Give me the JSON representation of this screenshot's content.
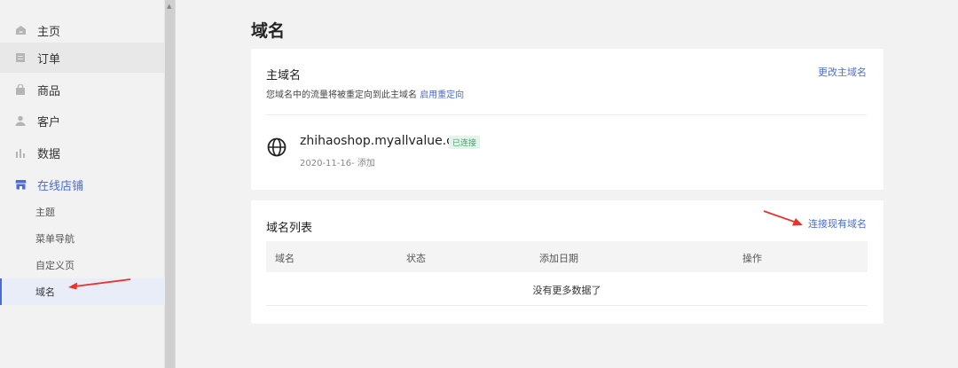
{
  "sidebar": {
    "items": [
      {
        "label": "主页",
        "icon": "home-icon"
      },
      {
        "label": "订单",
        "icon": "orders-icon"
      },
      {
        "label": "商品",
        "icon": "product-bag-icon"
      },
      {
        "label": "客户",
        "icon": "customer-icon"
      },
      {
        "label": "数据",
        "icon": "data-chart-icon"
      },
      {
        "label": "在线店铺",
        "icon": "online-store-icon"
      }
    ],
    "sub_items": [
      {
        "label": "主题"
      },
      {
        "label": "菜单导航"
      },
      {
        "label": "自定义页"
      },
      {
        "label": "域名"
      }
    ]
  },
  "page": {
    "title": "域名"
  },
  "primary_domain": {
    "title": "主域名",
    "change_link": "更改主域名",
    "description": "您域名中的流量将被重定向到此主域名",
    "enable_redirect_link": "启用重定向",
    "domain": "zhihaoshop.myallvalue.com",
    "status_badge": "已连接",
    "added": "2020-11-16- 添加"
  },
  "domain_list": {
    "title": "域名列表",
    "connect_link": "连接现有域名",
    "columns": [
      "域名",
      "状态",
      "添加日期",
      "操作"
    ],
    "empty_text": "没有更多数据了"
  },
  "colors": {
    "accent": "#4a6bd8",
    "connected_green": "#3aa76d",
    "annotation_arrow": "#e8322a"
  }
}
